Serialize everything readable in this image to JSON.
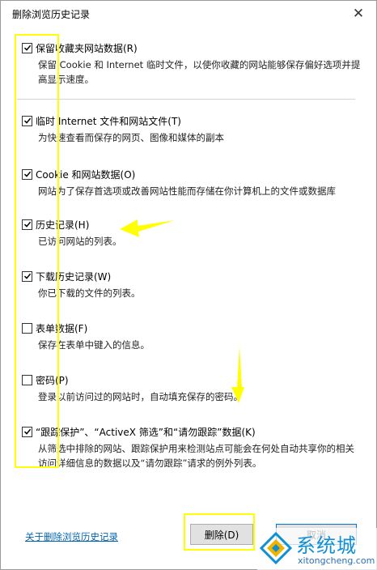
{
  "window": {
    "title": "删除浏览历史记录",
    "close_glyph": "✕"
  },
  "options": [
    {
      "label": "保留收藏夹网站数据(R)",
      "checked": true,
      "description": "保留 Cookie 和 Internet 临时文件，以使你收藏的网站能够保存偏好选项并提高显示速度。"
    },
    {
      "label": "临时 Internet 文件和网站文件(T)",
      "checked": true,
      "description": "为快速查看而保存的网页、图像和媒体的副本"
    },
    {
      "label": "Cookie 和网站数据(O)",
      "checked": true,
      "description": "网站为了保存首选项或改善网站性能而存储在你计算机上的文件或数据库"
    },
    {
      "label": "历史记录(H)",
      "checked": true,
      "description": "已访问网站的列表。"
    },
    {
      "label": "下载历史记录(W)",
      "checked": true,
      "description": "你已下载的文件的列表。"
    },
    {
      "label": "表单数据(F)",
      "checked": false,
      "description": "保存在表单中键入的信息。"
    },
    {
      "label": "密码(P)",
      "checked": false,
      "description": "登录以前访问过的网站时，自动填充保存的密码。"
    },
    {
      "label": "“跟踪保护”、“ActiveX 筛选”和“请勿跟踪”数据(K)",
      "checked": true,
      "description": "从筛选中排除的网站、跟踪保护用来检测站点可能会在何处自动共享你的相关访问详细信息的数据以及“请勿跟踪”请求的例外列表。"
    }
  ],
  "footer": {
    "help_link": "关于删除浏览历史记录",
    "delete_label": "删除(D)",
    "cancel_label": "取消"
  },
  "watermark": {
    "title": "系统城",
    "url": "xitongcheng.com"
  },
  "colors": {
    "link": "#0063b1",
    "annotation": "#ffff00",
    "watermark": "#0e8fd6"
  }
}
